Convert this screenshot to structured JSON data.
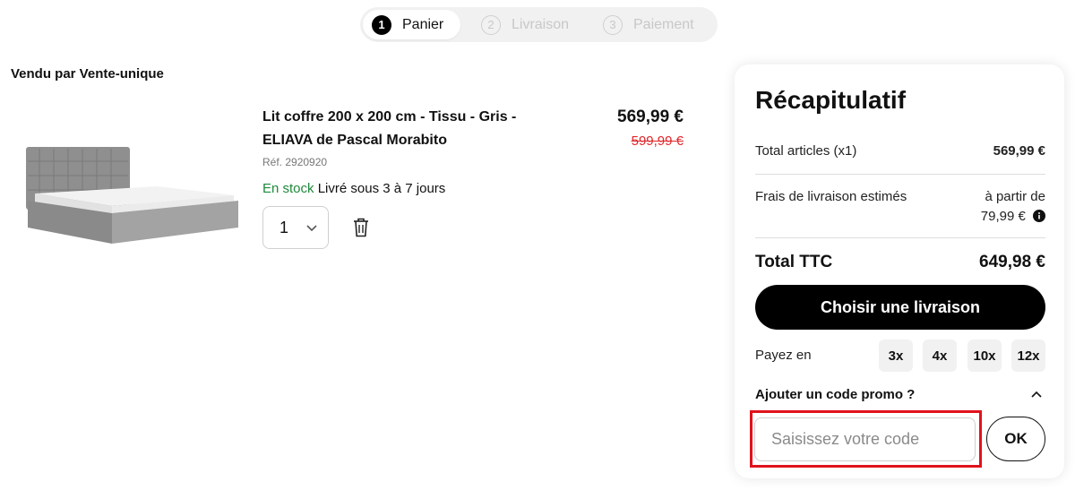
{
  "stepper": {
    "steps": [
      {
        "num": "1",
        "label": "Panier"
      },
      {
        "num": "2",
        "label": "Livraison"
      },
      {
        "num": "3",
        "label": "Paiement"
      }
    ]
  },
  "seller": "Vendu par Vente-unique",
  "product": {
    "title_line1": "Lit coffre 200 x 200 cm - Tissu - Gris -",
    "title_line2": "ELIAVA de Pascal Morabito",
    "ref": "Réf. 2920920",
    "stock": "En stock",
    "delivery": "Livré sous 3 à 7 jours",
    "quantity": "1",
    "price": "569,99 €",
    "old_price": "599,99 €",
    "image_icon": "bed-image"
  },
  "summary": {
    "title": "Récapitulatif",
    "articles_label": "Total articles (x1)",
    "articles_value": "569,99 €",
    "shipping_label": "Frais de livraison estimés",
    "shipping_value_line1": "à partir de",
    "shipping_value_line2": "79,99 €",
    "total_label": "Total TTC",
    "total_value": "649,98 €",
    "cta_label": "Choisir une livraison",
    "pay_label": "Payez en",
    "pay_options": [
      "3x",
      "4x",
      "10x",
      "12x"
    ],
    "promo_title": "Ajouter un code promo ?",
    "promo_placeholder": "Saisissez votre code",
    "promo_value": "",
    "ok_label": "OK"
  },
  "colors": {
    "accent": "#000000",
    "in_stock": "#1e8a3a",
    "old_price": "#e0262a",
    "highlight": "#e0121c"
  }
}
